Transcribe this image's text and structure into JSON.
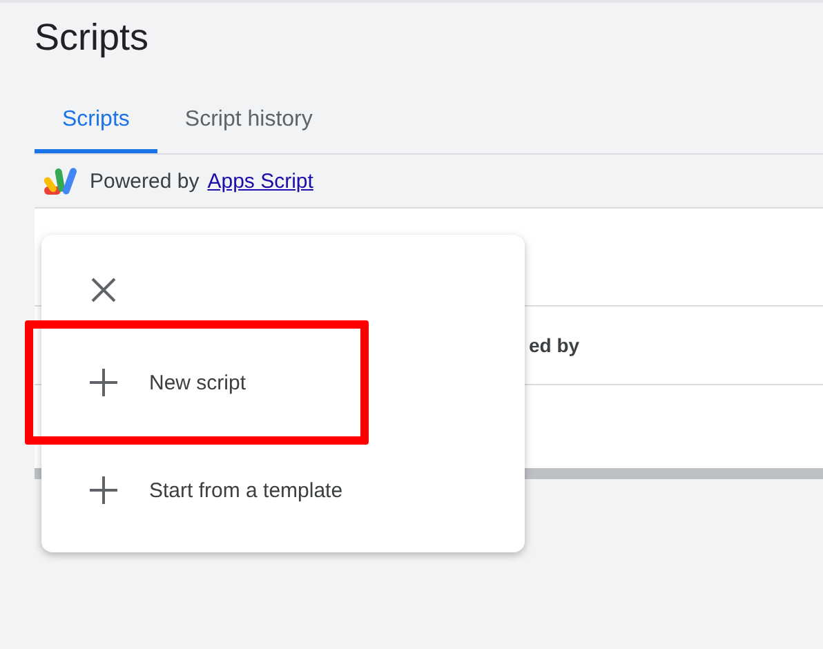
{
  "page": {
    "title": "Scripts"
  },
  "tabs": [
    {
      "label": "Scripts",
      "selected": true
    },
    {
      "label": "Script history",
      "selected": false
    }
  ],
  "powered_by": {
    "text": "Powered by",
    "link": "Apps Script"
  },
  "table": {
    "header_partial": "ed by"
  },
  "menu": {
    "items": [
      {
        "label": "New script",
        "highlighted": true
      },
      {
        "label": "Start from a template",
        "highlighted": false
      }
    ]
  }
}
